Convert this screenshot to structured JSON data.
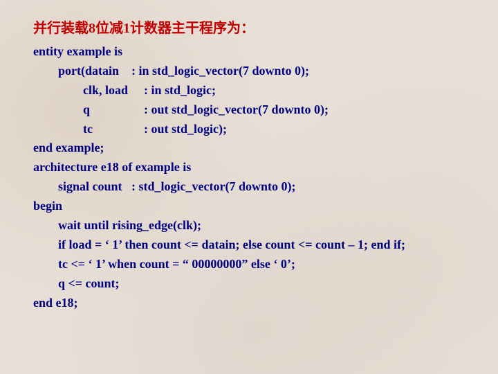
{
  "title": "并行装载8位减1计数器主干程序为：",
  "lines": {
    "l1": "entity example is",
    "l2a": "port(datain",
    "l2b": ": in std_logic_vector(7 downto 0);",
    "l3a": "clk, load",
    "l3b": ": in std_logic;",
    "l4a": "q",
    "l4b": ": out std_logic_vector(7 downto 0);",
    "l5a": "tc",
    "l5b": ": out std_logic);",
    "l6": "end example;",
    "l7": "architecture e18 of example is",
    "l8": "signal count   : std_logic_vector(7 downto 0);",
    "l9": "begin",
    "l10": "wait until rising_edge(clk);",
    "l11": "if load = ‘ 1’ then count <= datain; else count <= count – 1; end if;",
    "l12": "tc <= ‘ 1’ when count = “ 00000000” else ‘ 0’;",
    "l13": "q <= count;",
    "l14": "end e18;"
  }
}
